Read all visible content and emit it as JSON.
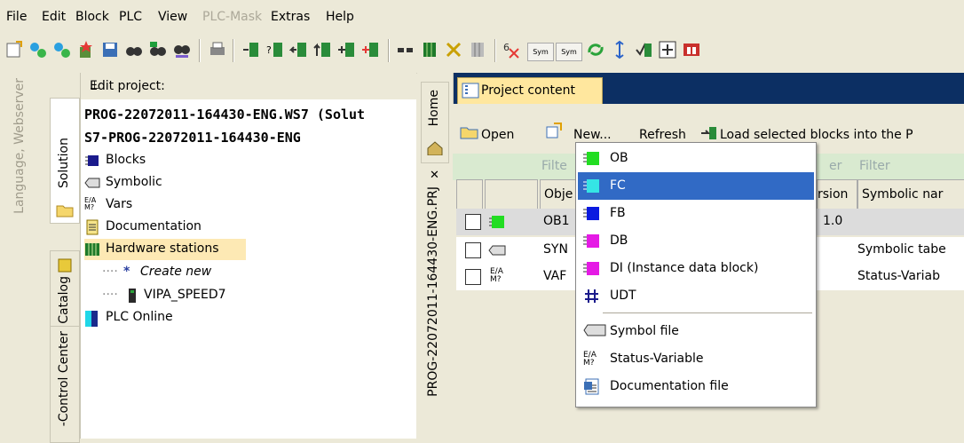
{
  "menubar": {
    "items": [
      "File",
      "Edit",
      "Block",
      "PLC",
      "View",
      "PLC-Mask",
      "Extras",
      "Help"
    ]
  },
  "toolbar": {
    "sym1": "Sym",
    "sym2": "Sym"
  },
  "side": {
    "language_label": "Language, Webserver",
    "tab_solution": "Solution",
    "tab_catalog": "Catalog",
    "tab_control": "-Control Center"
  },
  "tree": {
    "header": "Edit project:",
    "items": {
      "solution": "PROG-22072011-164430-ENG.WS7 (Solut",
      "project": "S7-PROG-22072011-164430-ENG",
      "blocks": "Blocks",
      "symbolic": "Symbolic",
      "vars": "Vars",
      "documentation": "Documentation",
      "hardware": "Hardware stations",
      "create_new": "Create new",
      "vipa": "VIPA_SPEED7",
      "plc_online": "PLC Online"
    }
  },
  "home": {
    "label": "Home",
    "project_label": "PROG-22072011-164430-ENG.PRJ"
  },
  "content": {
    "tab": "Project content",
    "toolbar": {
      "open": "Open",
      "new": "New...",
      "refresh": "Refresh",
      "load": "Load selected blocks into the P"
    },
    "filters": [
      "Filte",
      "er",
      "Filter"
    ],
    "columns": [
      "Obje",
      "rsion",
      "Symbolic nar"
    ],
    "rows": [
      {
        "obj": "OB1",
        "version": "1.0",
        "symbolic": ""
      },
      {
        "obj": "SYN",
        "version": "",
        "symbolic": "Symbolic tabe"
      },
      {
        "obj": "VAF",
        "version": "",
        "symbolic": "Status-Variab"
      }
    ]
  },
  "new_menu": {
    "items": [
      "OB",
      "FC",
      "FB",
      "DB",
      "DI (Instance data block)",
      "UDT",
      "Symbol file",
      "Status-Variable",
      "Documentation file"
    ],
    "selected": "FC"
  },
  "colors": {
    "selection": "#316ac5",
    "accent_dark": "#0c2f63",
    "tab_yellow": "#ffe79e",
    "highlight": "#fde9b4"
  }
}
